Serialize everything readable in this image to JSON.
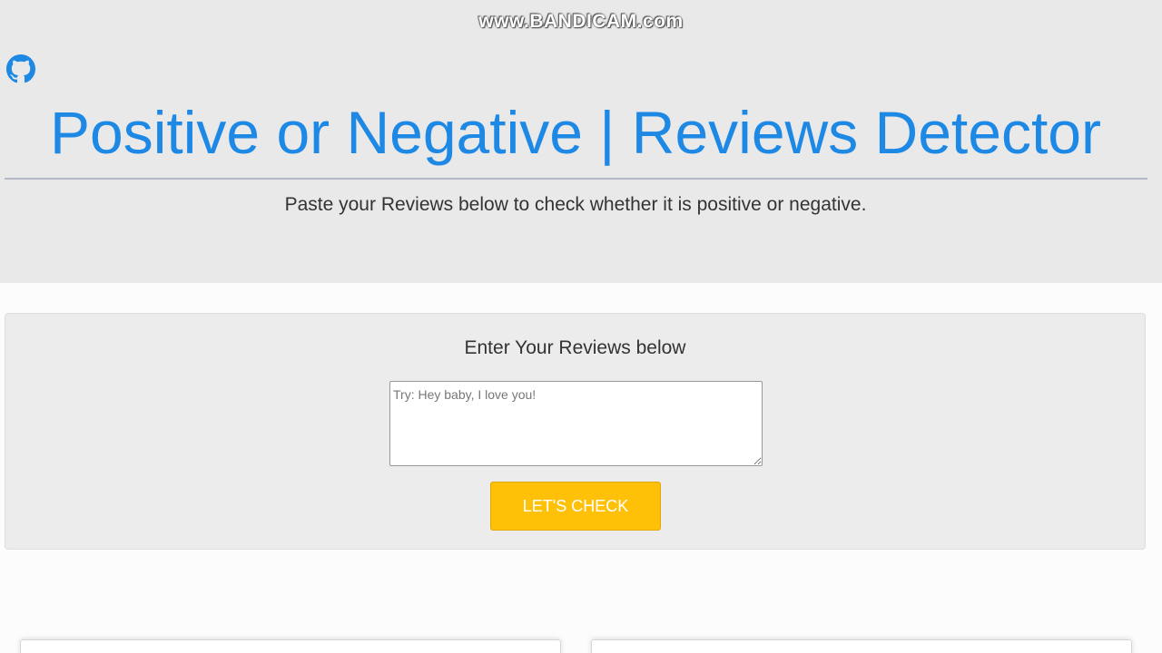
{
  "watermark": "www.BANDICAM.com",
  "header": {
    "github_icon": "github-icon",
    "title": "Positive or Negative | Reviews Detector",
    "subtitle": "Paste your Reviews below to check whether it is positive or negative."
  },
  "review_panel": {
    "heading": "Enter Your Reviews below",
    "input_placeholder": "Try: Hey baby, I love you!",
    "input_value": "",
    "button_label": "LET'S CHECK"
  },
  "colors": {
    "title_blue": "#1e88e5",
    "button_yellow": "#ffc107",
    "header_bg": "#e9e9e9"
  }
}
